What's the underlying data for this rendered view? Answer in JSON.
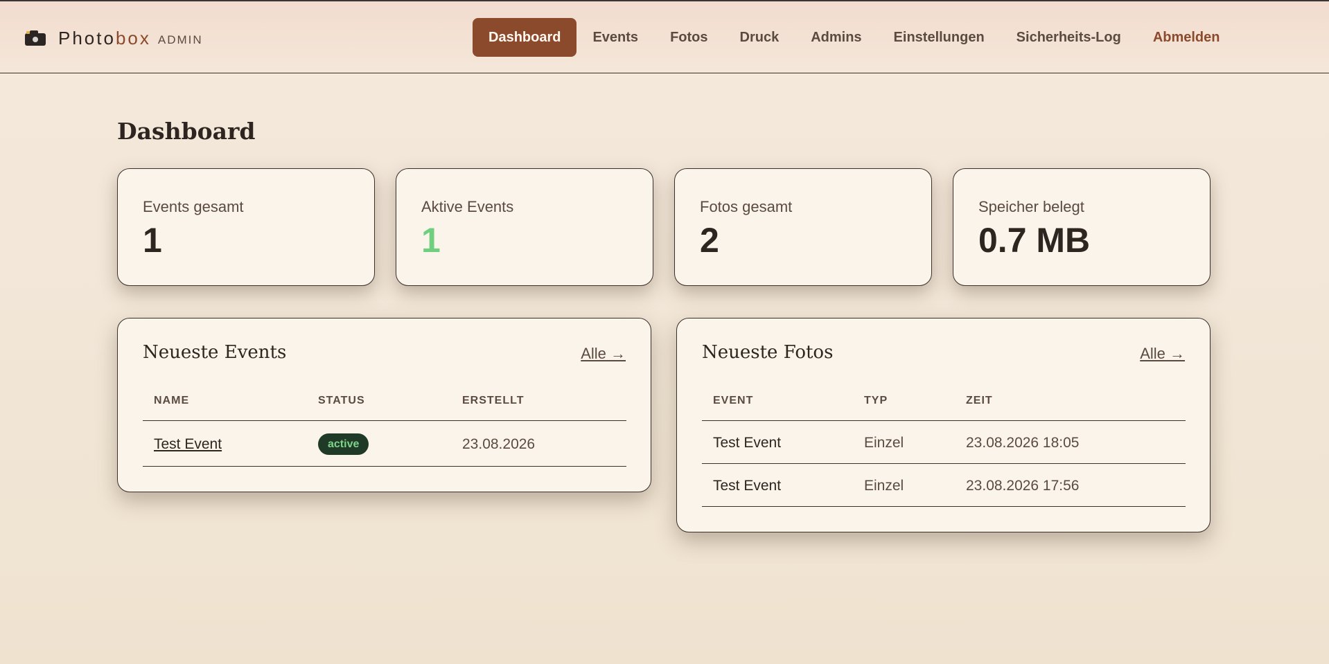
{
  "header": {
    "brand_main": "Photo",
    "brand_accent": "box",
    "brand_sub": "ADMIN",
    "nav": {
      "dashboard": "Dashboard",
      "events": "Events",
      "fotos": "Fotos",
      "druck": "Druck",
      "admins": "Admins",
      "einstellungen": "Einstellungen",
      "sicherheitslog": "Sicherheits-Log",
      "abmelden": "Abmelden"
    }
  },
  "page": {
    "title": "Dashboard"
  },
  "stats": {
    "events_total": {
      "label": "Events gesamt",
      "value": "1"
    },
    "events_active": {
      "label": "Aktive Events",
      "value": "1"
    },
    "photos_total": {
      "label": "Fotos gesamt",
      "value": "2"
    },
    "storage": {
      "label": "Speicher belegt",
      "value": "0.7 MB"
    }
  },
  "recent_events": {
    "title": "Neueste Events",
    "link": "Alle →",
    "columns": [
      "NAME",
      "STATUS",
      "ERSTELLT"
    ],
    "rows": [
      {
        "name": "Test Event",
        "status": "active",
        "created": "23.08.2026"
      }
    ]
  },
  "recent_photos": {
    "title": "Neueste Fotos",
    "link": "Alle →",
    "columns": [
      "EVENT",
      "TYP",
      "ZEIT"
    ],
    "rows": [
      {
        "event": "Test Event",
        "type": "Einzel",
        "time": "23.08.2026 18:05"
      },
      {
        "event": "Test Event",
        "type": "Einzel",
        "time": "23.08.2026 17:56"
      }
    ]
  },
  "colors": {
    "accent": "#8b4a2b",
    "active_green": "#6fcf7e",
    "badge_bg": "#1f3a26"
  }
}
